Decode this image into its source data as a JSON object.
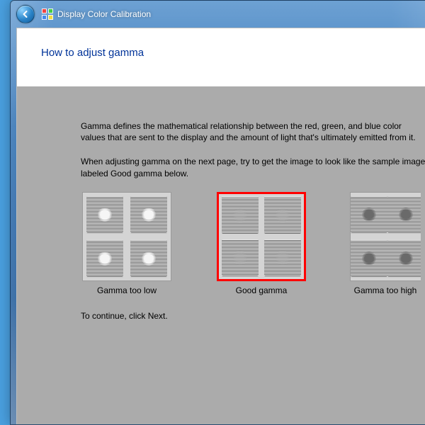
{
  "window": {
    "title": "Display Color Calibration"
  },
  "page": {
    "heading": "How to adjust gamma",
    "paragraph1": "Gamma defines the mathematical relationship between the red, green, and blue color values that are sent to the display and the amount of light that's ultimately emitted from it.",
    "paragraph2": "When adjusting gamma on the next page, try to get the image to look like the sample image labeled Good gamma below.",
    "continue_text": "To continue, click Next."
  },
  "samples": {
    "low": {
      "caption": "Gamma too low"
    },
    "good": {
      "caption": "Good gamma"
    },
    "high": {
      "caption": "Gamma too high"
    }
  }
}
